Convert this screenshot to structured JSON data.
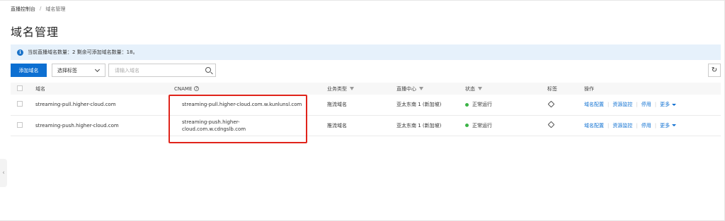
{
  "breadcrumb": {
    "root": "直播控制台",
    "sep": "/",
    "current": "域名管理"
  },
  "page": {
    "title": "域名管理"
  },
  "notice": {
    "text": "当前直播域名数量：2 剩余可添加域名数量：18。"
  },
  "toolbar": {
    "add_label": "添加域名",
    "tag_select_label": "选择标签",
    "search_placeholder": "请输入域名"
  },
  "table": {
    "headers": {
      "domain": "域名",
      "cname": "CNAME",
      "type": "业务类型",
      "center": "直播中心",
      "status": "状态",
      "tag": "标签",
      "actions": "操作"
    },
    "rows": [
      {
        "domain": "streaming-pull.higher-cloud.com",
        "cname_line1": "streaming-pull.higher-cloud.com.w.kunlunsl.com",
        "cname_line2": "",
        "type": "拖流域名",
        "center": "亚太东南 1 (新加坡)",
        "status": "正常运行",
        "actions": {
          "config": "域名配置",
          "monitor": "资源监控",
          "disable": "停用",
          "more": "更多"
        }
      },
      {
        "domain": "streaming-push.higher-cloud.com",
        "cname_line1": "streaming-push.higher-",
        "cname_line2": "cloud.com.w.cdngslb.com",
        "type": "推流域名",
        "center": "亚太东南 1 (新加坡)",
        "status": "正常运行",
        "actions": {
          "config": "域名配置",
          "monitor": "资源监控",
          "disable": "停用",
          "more": "更多"
        }
      }
    ]
  },
  "colors": {
    "primary": "#0d6fd1",
    "status_ok": "#3bb346",
    "highlight": "#e0241b",
    "notice_bg": "#e6f1fb"
  }
}
